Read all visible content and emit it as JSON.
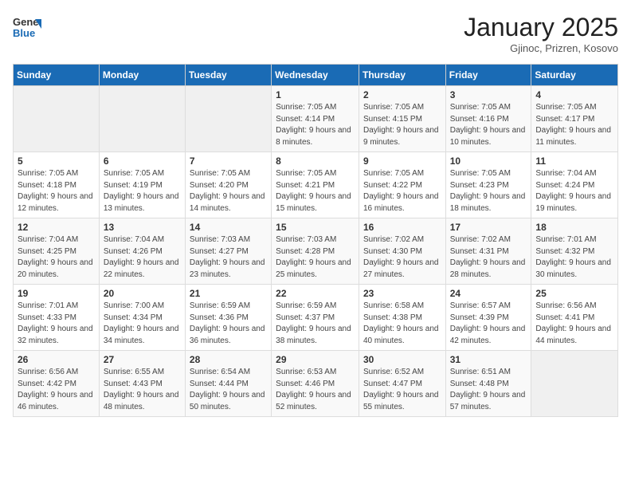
{
  "header": {
    "logo_general": "General",
    "logo_blue": "Blue",
    "title": "January 2025",
    "subtitle": "Gjinoc, Prizren, Kosovo"
  },
  "weekdays": [
    "Sunday",
    "Monday",
    "Tuesday",
    "Wednesday",
    "Thursday",
    "Friday",
    "Saturday"
  ],
  "weeks": [
    [
      {
        "day": "",
        "sunrise": "",
        "sunset": "",
        "daylight": ""
      },
      {
        "day": "",
        "sunrise": "",
        "sunset": "",
        "daylight": ""
      },
      {
        "day": "",
        "sunrise": "",
        "sunset": "",
        "daylight": ""
      },
      {
        "day": "1",
        "sunrise": "Sunrise: 7:05 AM",
        "sunset": "Sunset: 4:14 PM",
        "daylight": "Daylight: 9 hours and 8 minutes."
      },
      {
        "day": "2",
        "sunrise": "Sunrise: 7:05 AM",
        "sunset": "Sunset: 4:15 PM",
        "daylight": "Daylight: 9 hours and 9 minutes."
      },
      {
        "day": "3",
        "sunrise": "Sunrise: 7:05 AM",
        "sunset": "Sunset: 4:16 PM",
        "daylight": "Daylight: 9 hours and 10 minutes."
      },
      {
        "day": "4",
        "sunrise": "Sunrise: 7:05 AM",
        "sunset": "Sunset: 4:17 PM",
        "daylight": "Daylight: 9 hours and 11 minutes."
      }
    ],
    [
      {
        "day": "5",
        "sunrise": "Sunrise: 7:05 AM",
        "sunset": "Sunset: 4:18 PM",
        "daylight": "Daylight: 9 hours and 12 minutes."
      },
      {
        "day": "6",
        "sunrise": "Sunrise: 7:05 AM",
        "sunset": "Sunset: 4:19 PM",
        "daylight": "Daylight: 9 hours and 13 minutes."
      },
      {
        "day": "7",
        "sunrise": "Sunrise: 7:05 AM",
        "sunset": "Sunset: 4:20 PM",
        "daylight": "Daylight: 9 hours and 14 minutes."
      },
      {
        "day": "8",
        "sunrise": "Sunrise: 7:05 AM",
        "sunset": "Sunset: 4:21 PM",
        "daylight": "Daylight: 9 hours and 15 minutes."
      },
      {
        "day": "9",
        "sunrise": "Sunrise: 7:05 AM",
        "sunset": "Sunset: 4:22 PM",
        "daylight": "Daylight: 9 hours and 16 minutes."
      },
      {
        "day": "10",
        "sunrise": "Sunrise: 7:05 AM",
        "sunset": "Sunset: 4:23 PM",
        "daylight": "Daylight: 9 hours and 18 minutes."
      },
      {
        "day": "11",
        "sunrise": "Sunrise: 7:04 AM",
        "sunset": "Sunset: 4:24 PM",
        "daylight": "Daylight: 9 hours and 19 minutes."
      }
    ],
    [
      {
        "day": "12",
        "sunrise": "Sunrise: 7:04 AM",
        "sunset": "Sunset: 4:25 PM",
        "daylight": "Daylight: 9 hours and 20 minutes."
      },
      {
        "day": "13",
        "sunrise": "Sunrise: 7:04 AM",
        "sunset": "Sunset: 4:26 PM",
        "daylight": "Daylight: 9 hours and 22 minutes."
      },
      {
        "day": "14",
        "sunrise": "Sunrise: 7:03 AM",
        "sunset": "Sunset: 4:27 PM",
        "daylight": "Daylight: 9 hours and 23 minutes."
      },
      {
        "day": "15",
        "sunrise": "Sunrise: 7:03 AM",
        "sunset": "Sunset: 4:28 PM",
        "daylight": "Daylight: 9 hours and 25 minutes."
      },
      {
        "day": "16",
        "sunrise": "Sunrise: 7:02 AM",
        "sunset": "Sunset: 4:30 PM",
        "daylight": "Daylight: 9 hours and 27 minutes."
      },
      {
        "day": "17",
        "sunrise": "Sunrise: 7:02 AM",
        "sunset": "Sunset: 4:31 PM",
        "daylight": "Daylight: 9 hours and 28 minutes."
      },
      {
        "day": "18",
        "sunrise": "Sunrise: 7:01 AM",
        "sunset": "Sunset: 4:32 PM",
        "daylight": "Daylight: 9 hours and 30 minutes."
      }
    ],
    [
      {
        "day": "19",
        "sunrise": "Sunrise: 7:01 AM",
        "sunset": "Sunset: 4:33 PM",
        "daylight": "Daylight: 9 hours and 32 minutes."
      },
      {
        "day": "20",
        "sunrise": "Sunrise: 7:00 AM",
        "sunset": "Sunset: 4:34 PM",
        "daylight": "Daylight: 9 hours and 34 minutes."
      },
      {
        "day": "21",
        "sunrise": "Sunrise: 6:59 AM",
        "sunset": "Sunset: 4:36 PM",
        "daylight": "Daylight: 9 hours and 36 minutes."
      },
      {
        "day": "22",
        "sunrise": "Sunrise: 6:59 AM",
        "sunset": "Sunset: 4:37 PM",
        "daylight": "Daylight: 9 hours and 38 minutes."
      },
      {
        "day": "23",
        "sunrise": "Sunrise: 6:58 AM",
        "sunset": "Sunset: 4:38 PM",
        "daylight": "Daylight: 9 hours and 40 minutes."
      },
      {
        "day": "24",
        "sunrise": "Sunrise: 6:57 AM",
        "sunset": "Sunset: 4:39 PM",
        "daylight": "Daylight: 9 hours and 42 minutes."
      },
      {
        "day": "25",
        "sunrise": "Sunrise: 6:56 AM",
        "sunset": "Sunset: 4:41 PM",
        "daylight": "Daylight: 9 hours and 44 minutes."
      }
    ],
    [
      {
        "day": "26",
        "sunrise": "Sunrise: 6:56 AM",
        "sunset": "Sunset: 4:42 PM",
        "daylight": "Daylight: 9 hours and 46 minutes."
      },
      {
        "day": "27",
        "sunrise": "Sunrise: 6:55 AM",
        "sunset": "Sunset: 4:43 PM",
        "daylight": "Daylight: 9 hours and 48 minutes."
      },
      {
        "day": "28",
        "sunrise": "Sunrise: 6:54 AM",
        "sunset": "Sunset: 4:44 PM",
        "daylight": "Daylight: 9 hours and 50 minutes."
      },
      {
        "day": "29",
        "sunrise": "Sunrise: 6:53 AM",
        "sunset": "Sunset: 4:46 PM",
        "daylight": "Daylight: 9 hours and 52 minutes."
      },
      {
        "day": "30",
        "sunrise": "Sunrise: 6:52 AM",
        "sunset": "Sunset: 4:47 PM",
        "daylight": "Daylight: 9 hours and 55 minutes."
      },
      {
        "day": "31",
        "sunrise": "Sunrise: 6:51 AM",
        "sunset": "Sunset: 4:48 PM",
        "daylight": "Daylight: 9 hours and 57 minutes."
      },
      {
        "day": "",
        "sunrise": "",
        "sunset": "",
        "daylight": ""
      }
    ]
  ]
}
